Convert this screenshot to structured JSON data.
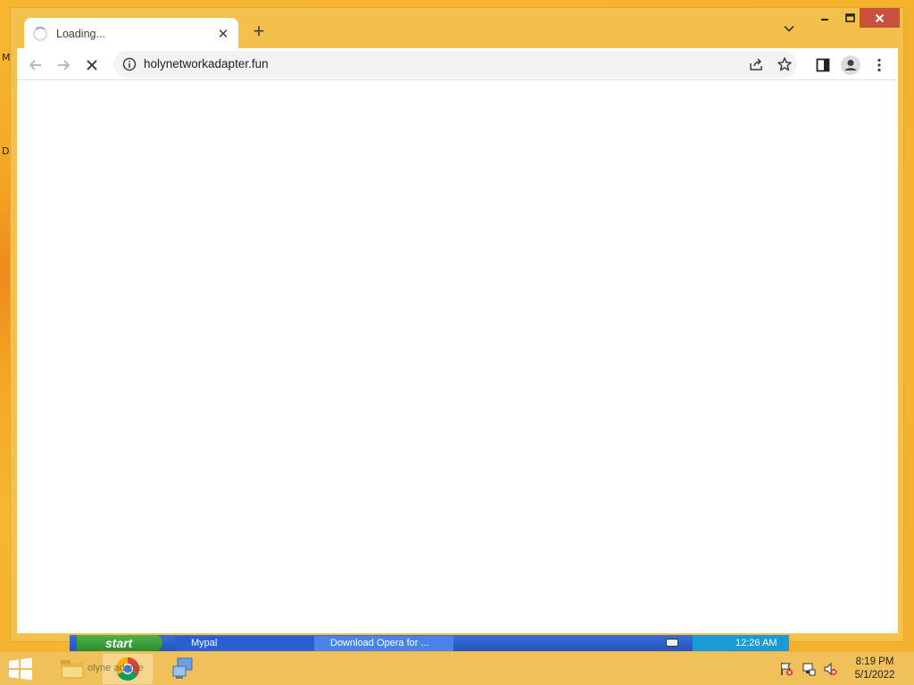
{
  "desktop": {
    "glyph_1": "M",
    "glyph_2": "D"
  },
  "browser": {
    "tab": {
      "title": "Loading...",
      "close_symbol": "✕"
    },
    "new_tab_symbol": "+",
    "omnibox": {
      "url": "holynetworkadapter.fun"
    }
  },
  "xp_taskbar": {
    "start_label": "start",
    "buttons": [
      "Mypal",
      "Download Opera for ..."
    ],
    "clock": "12:26 AM"
  },
  "taskbar": {
    "ghost_label": "olyne     adapte",
    "clock": {
      "time": "8:19 PM",
      "date": "5/1/2022"
    }
  },
  "colors": {
    "frame": "#f3c04c",
    "close_button": "#c94f3e",
    "taskbar": "#f0c05a"
  }
}
